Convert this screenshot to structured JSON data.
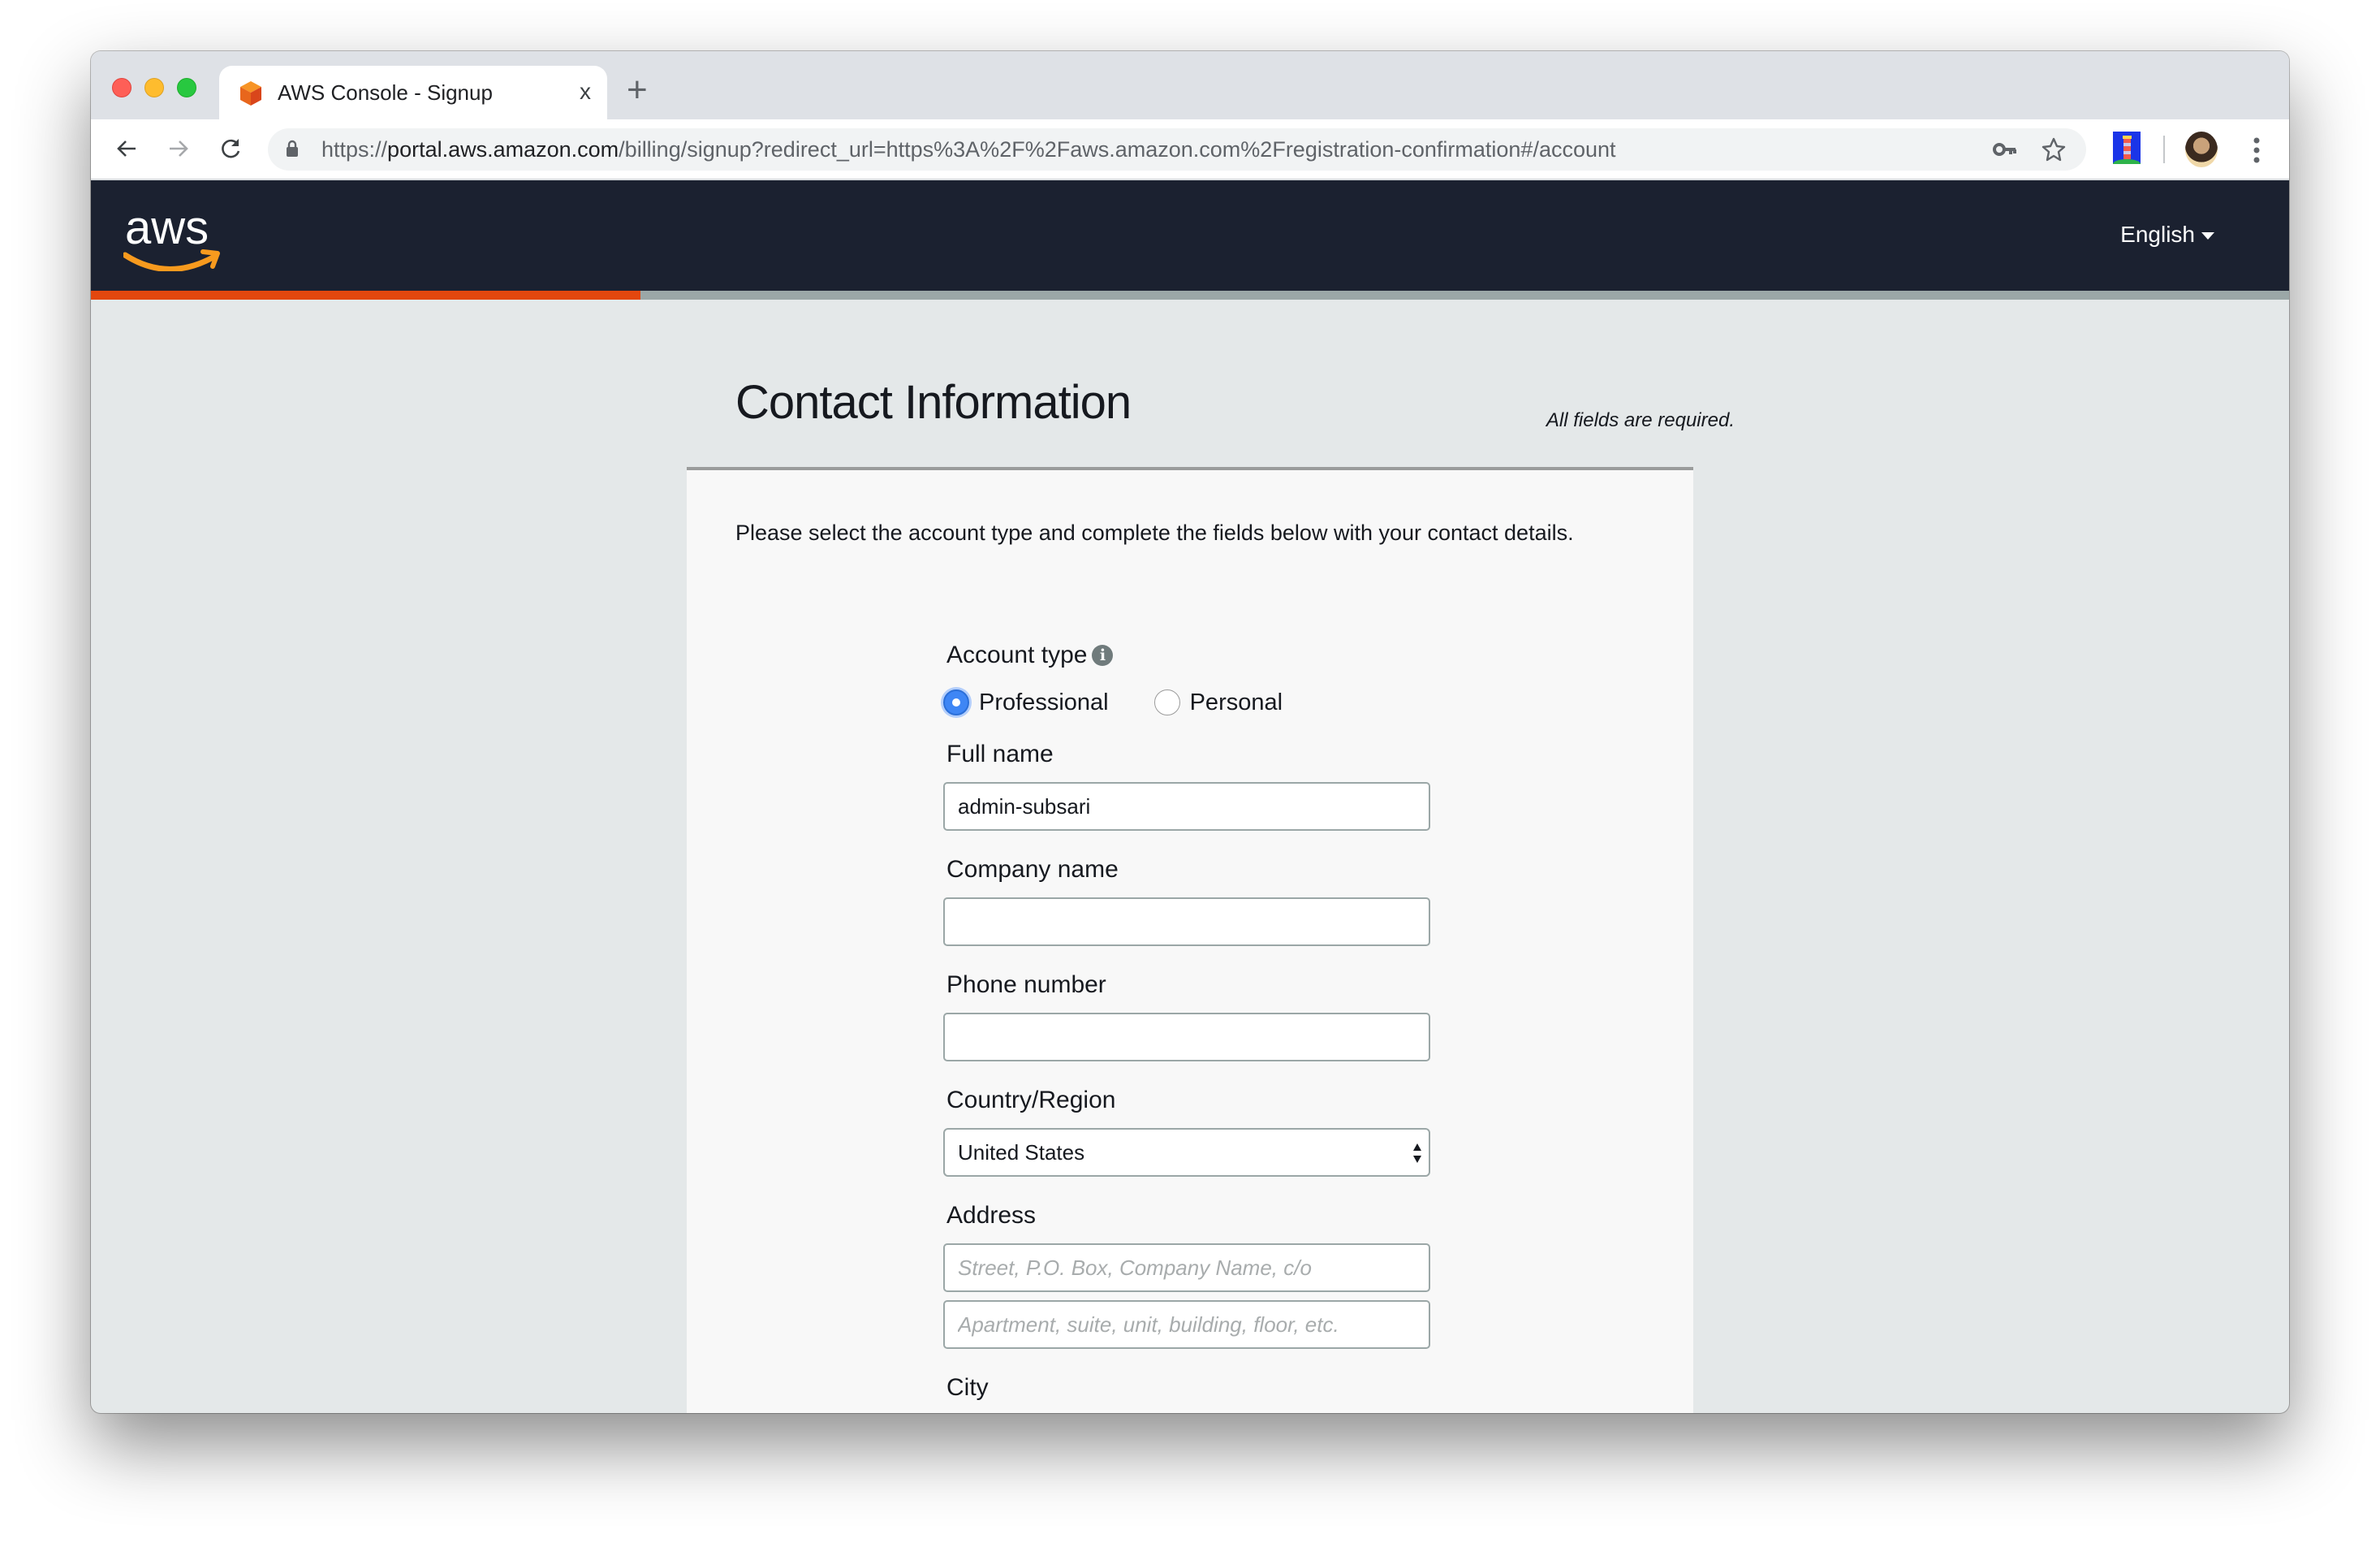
{
  "browser": {
    "tab_title": "AWS Console - Signup",
    "tab_close_glyph": "x",
    "new_tab_glyph": "+",
    "url_scheme": "https://",
    "url_host": "portal.aws.amazon.com",
    "url_path": "/billing/signup?redirect_url=https%3A%2F%2Faws.amazon.com%2Fregistration-confirmation#/account",
    "icons": [
      "back-icon",
      "forward-icon",
      "reload-icon",
      "lock-icon",
      "key-icon",
      "star-icon",
      "lighthouse-extension-icon",
      "profile-avatar",
      "menu-dots-icon"
    ]
  },
  "header": {
    "logo_text": "aws",
    "language": "English",
    "progress_fraction": 0.25,
    "colors": {
      "nav_bg": "#1B2130",
      "progress": "#E3470E",
      "progress_track": "#9BA7A7"
    }
  },
  "page": {
    "title": "Contact Information",
    "required_note": "All fields are required.",
    "intro": "Please select the account type and complete the fields below with your contact details."
  },
  "form": {
    "account_type": {
      "label": "Account type",
      "options": [
        {
          "label": "Professional",
          "checked": true
        },
        {
          "label": "Personal",
          "checked": false
        }
      ]
    },
    "full_name": {
      "label": "Full name",
      "value": "admin-subsari"
    },
    "company_name": {
      "label": "Company name",
      "value": ""
    },
    "phone_number": {
      "label": "Phone number",
      "value": ""
    },
    "country": {
      "label": "Country/Region",
      "value": "United States"
    },
    "address": {
      "label": "Address",
      "line1_placeholder": "Street, P.O. Box, Company Name, c/o",
      "line2_placeholder": "Apartment, suite, unit, building, floor, etc."
    },
    "city": {
      "label": "City",
      "value": ""
    }
  }
}
